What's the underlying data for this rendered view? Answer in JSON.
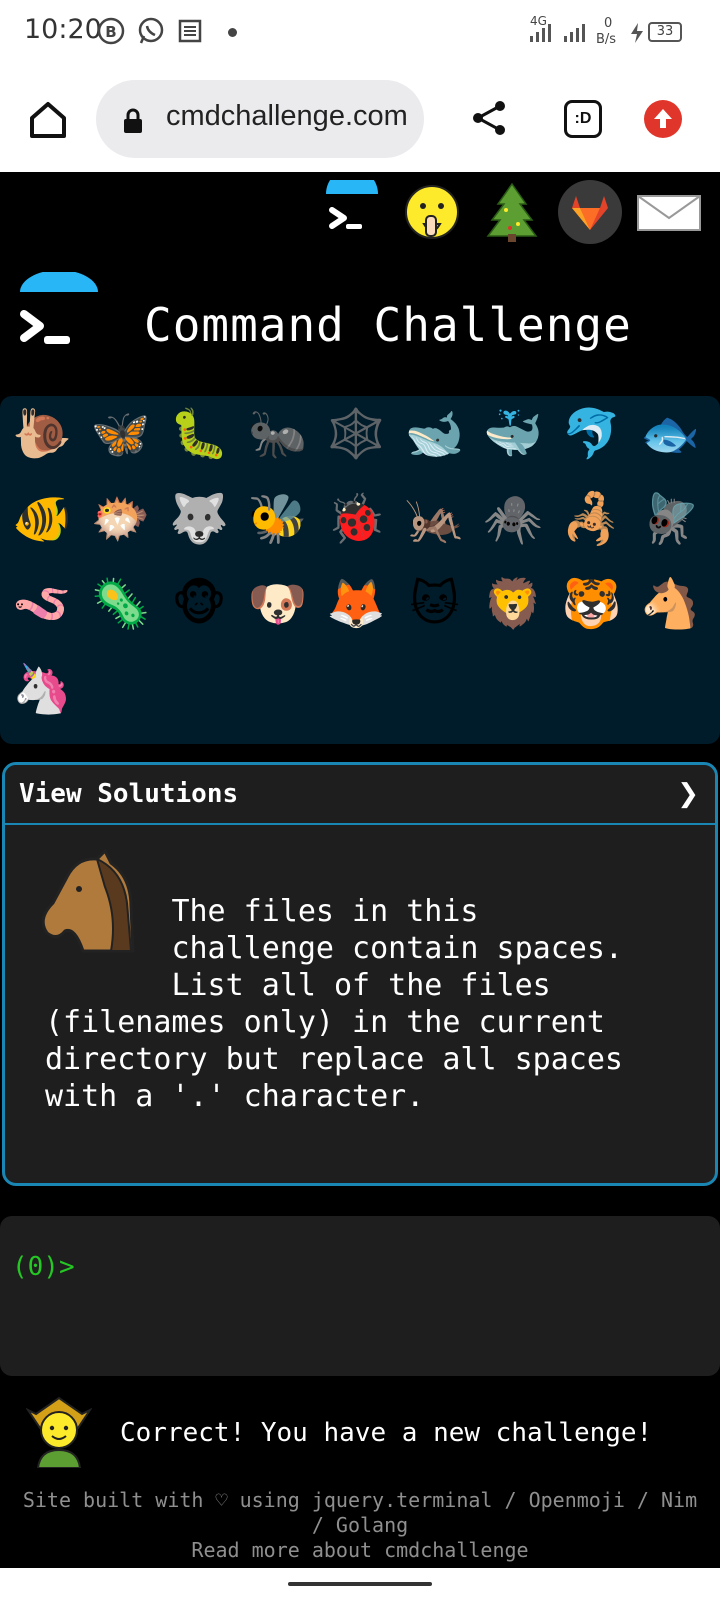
{
  "status_bar": {
    "time": "10:20",
    "network_label": "4G",
    "data_rate": "0",
    "data_unit": "B/s",
    "battery": "33"
  },
  "browser": {
    "url": "cmdchallenge.com",
    "tab_label": ":D"
  },
  "top_nav": [
    "terminal-icon",
    "shushing-face-icon",
    "christmas-tree-icon",
    "gitlab-icon",
    "envelope-icon"
  ],
  "site_title": "Command Challenge",
  "animals": {
    "row1": [
      "🐌",
      "🦋",
      "🐛",
      "🐜",
      "🕸️",
      "🐋",
      "🐳",
      "🐬",
      "🐟"
    ],
    "row2": [
      "🐠",
      "🐡",
      "🐺",
      "🐝",
      "🐞",
      "🦗",
      "🕷️",
      "🦂",
      "🪰"
    ],
    "row3": [
      "🪱",
      "🦠",
      "🐵",
      "🐶",
      "🦊",
      "🐱",
      "🦁",
      "🐯",
      "🐴"
    ],
    "row4": [
      "🦄"
    ]
  },
  "panel": {
    "title": "View Solutions",
    "chevron": "❯",
    "challenge_text": "       The files in this\n       challenge contain spaces.\n       List all of the files\n(filenames only) in the current\ndirectory but replace all spaces\nwith a '.' character."
  },
  "terminal": {
    "prompt": "(0)>"
  },
  "status_message": "Correct! You have a new challenge!",
  "footer": {
    "line1": "Site built with ♡ using jquery.terminal / Openmoji / Nim",
    "line2": "/ Golang",
    "line3": "Read more about cmdchallenge"
  }
}
